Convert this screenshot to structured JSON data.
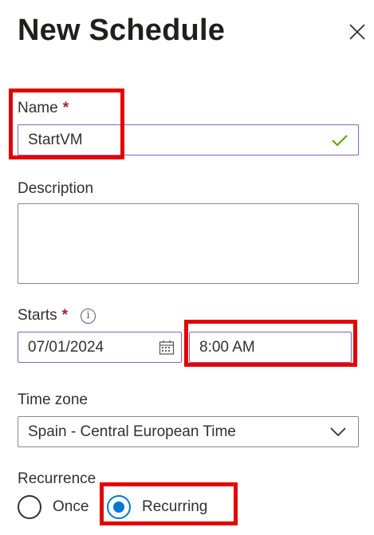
{
  "panel": {
    "title": "New Schedule",
    "close_icon": "close-icon"
  },
  "name": {
    "label": "Name",
    "required_mark": "*",
    "value": "StartVM",
    "valid_icon": "checkmark-icon"
  },
  "description": {
    "label": "Description",
    "value": ""
  },
  "starts": {
    "label": "Starts",
    "required_mark": "*",
    "info_icon": "info-icon",
    "date_value": "07/01/2024",
    "calendar_icon": "calendar-icon",
    "time_value": "8:00 AM"
  },
  "timezone": {
    "label": "Time zone",
    "selected": "Spain - Central European Time",
    "chevron_icon": "chevron-down-icon"
  },
  "recurrence": {
    "label": "Recurrence",
    "options": [
      {
        "label": "Once",
        "checked": false
      },
      {
        "label": "Recurring",
        "checked": true
      }
    ]
  },
  "colors": {
    "accent": "#0078d4",
    "required": "#a4262c",
    "valid_check": "#57a300",
    "focus_border": "#8764b8",
    "highlight": "#e60000"
  }
}
